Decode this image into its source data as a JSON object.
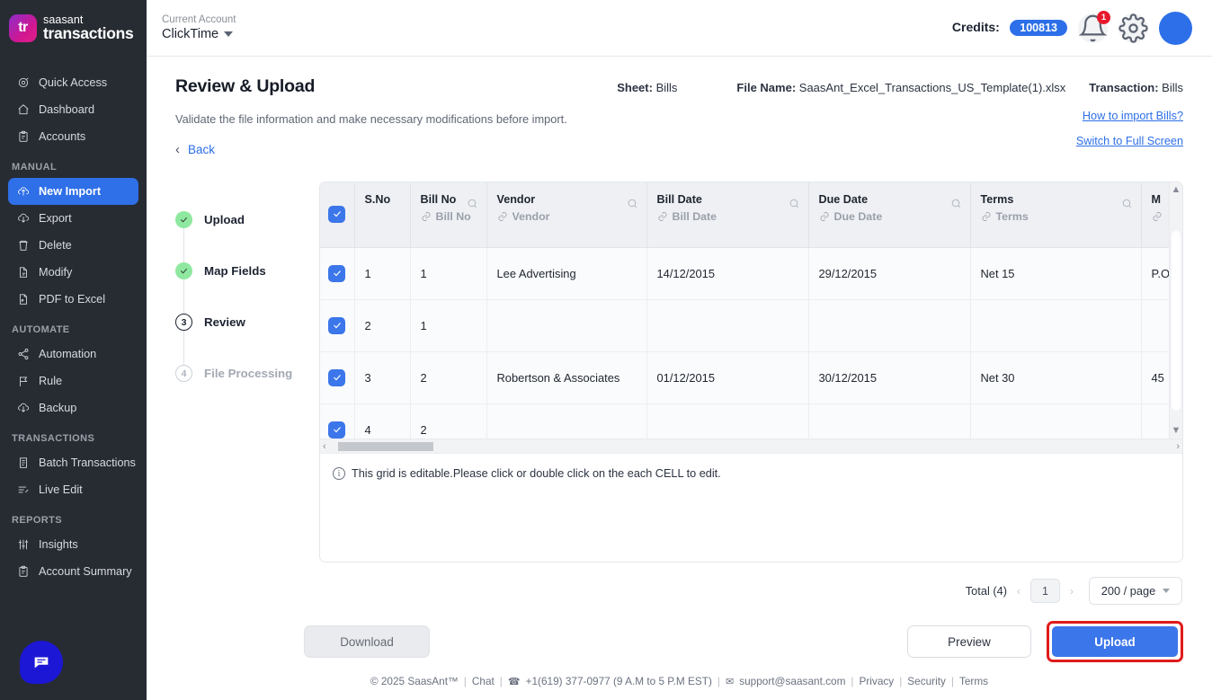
{
  "brand": {
    "line1": "saasant",
    "line2": "transactions",
    "mark": "tr"
  },
  "account": {
    "label": "Current Account",
    "value": "ClickTime"
  },
  "topbar": {
    "credits_label": "Credits:",
    "credits_value": "100813",
    "notification_count": "1",
    "icons": {
      "bell": "bell-icon",
      "gear": "gear-icon",
      "avatar": "avatar"
    }
  },
  "sidebar": {
    "items": [
      {
        "label": "Quick Access",
        "icon": "target-icon",
        "active": false
      },
      {
        "label": "Dashboard",
        "icon": "home-icon",
        "active": false
      },
      {
        "label": "Accounts",
        "icon": "clipboard-icon",
        "active": false
      }
    ],
    "sections": [
      {
        "title": "MANUAL",
        "items": [
          {
            "label": "New Import",
            "icon": "upload-cloud-icon",
            "active": true
          },
          {
            "label": "Export",
            "icon": "download-cloud-icon",
            "active": false
          },
          {
            "label": "Delete",
            "icon": "trash-icon",
            "active": false
          },
          {
            "label": "Modify",
            "icon": "file-edit-icon",
            "active": false
          },
          {
            "label": "PDF to Excel",
            "icon": "pdf-file-icon",
            "active": false
          }
        ]
      },
      {
        "title": "AUTOMATE",
        "items": [
          {
            "label": "Automation",
            "icon": "share-nodes-icon",
            "active": false
          },
          {
            "label": "Rule",
            "icon": "rule-flag-icon",
            "active": false
          },
          {
            "label": "Backup",
            "icon": "backup-cloud-icon",
            "active": false
          }
        ]
      },
      {
        "title": "TRANSACTIONS",
        "items": [
          {
            "label": "Batch Transactions",
            "icon": "document-icon",
            "active": false
          },
          {
            "label": "Live Edit",
            "icon": "live-edit-icon",
            "active": false
          }
        ]
      },
      {
        "title": "REPORTS",
        "items": [
          {
            "label": "Insights",
            "icon": "sliders-icon",
            "active": false
          },
          {
            "label": "Account Summary",
            "icon": "clipboard-icon",
            "active": false
          }
        ]
      }
    ],
    "chat_widget": "chat-bubble-icon"
  },
  "page": {
    "title": "Review & Upload",
    "subtitle": "Validate the file information and make necessary modifications before import.",
    "sheet_label": "Sheet:",
    "sheet_value": "Bills",
    "file_label": "File Name:",
    "file_value": "SaasAnt_Excel_Transactions_US_Template(1).xlsx",
    "transaction_label": "Transaction:",
    "transaction_value": "Bills",
    "back_label": "Back",
    "link_how_to": "How to import Bills?",
    "link_fullscreen": "Switch to Full Screen"
  },
  "stepper": [
    {
      "label": "Upload",
      "state": "done",
      "marker": "check"
    },
    {
      "label": "Map Fields",
      "state": "done",
      "marker": "check"
    },
    {
      "label": "Review",
      "state": "current",
      "marker": "3"
    },
    {
      "label": "File Processing",
      "state": "todo",
      "marker": "4"
    }
  ],
  "table": {
    "columns": [
      {
        "name": "S.No",
        "mapped": "",
        "searchable": false
      },
      {
        "name": "Bill No",
        "mapped": "Bill No",
        "searchable": true
      },
      {
        "name": "Vendor",
        "mapped": "Vendor",
        "searchable": true
      },
      {
        "name": "Bill Date",
        "mapped": "Bill Date",
        "searchable": true
      },
      {
        "name": "Due Date",
        "mapped": "Due Date",
        "searchable": true
      },
      {
        "name": "Terms",
        "mapped": "Terms",
        "searchable": true
      },
      {
        "name": "M",
        "mapped": "",
        "searchable": false
      }
    ],
    "rows": [
      {
        "checked": true,
        "sno": "1",
        "bill_no": "1",
        "vendor": "Lee Advertising",
        "bill_date": "14/12/2015",
        "due_date": "29/12/2015",
        "terms": "Net 15",
        "memo": "P.O"
      },
      {
        "checked": true,
        "sno": "2",
        "bill_no": "1",
        "vendor": "",
        "bill_date": "",
        "due_date": "",
        "terms": "",
        "memo": ""
      },
      {
        "checked": true,
        "sno": "3",
        "bill_no": "2",
        "vendor": "Robertson & Associates",
        "bill_date": "01/12/2015",
        "due_date": "30/12/2015",
        "terms": "Net 30",
        "memo": "45"
      },
      {
        "checked": true,
        "sno": "4",
        "bill_no": "2",
        "vendor": "",
        "bill_date": "",
        "due_date": "",
        "terms": "",
        "memo": ""
      }
    ],
    "note": "This grid is editable.Please click or double click on the each CELL to edit.",
    "header_select_all_checked": true
  },
  "pagination": {
    "total": "Total (4)",
    "current_page": "1",
    "page_size": "200 / page"
  },
  "buttons": {
    "download": "Download",
    "preview": "Preview",
    "upload": "Upload"
  },
  "footer": {
    "copyright": "© 2025 SaasAnt™",
    "chat": "Chat",
    "phone": "+1(619) 377-0977 (9 A.M to 5 P.M EST)",
    "email": "support@saasant.com",
    "privacy": "Privacy",
    "security": "Security",
    "terms": "Terms"
  },
  "colors": {
    "accent": "#3b76ea",
    "sidebar_bg": "#272c33",
    "highlight_ring": "#e01b1b",
    "step_done": "#8fe8a0"
  }
}
